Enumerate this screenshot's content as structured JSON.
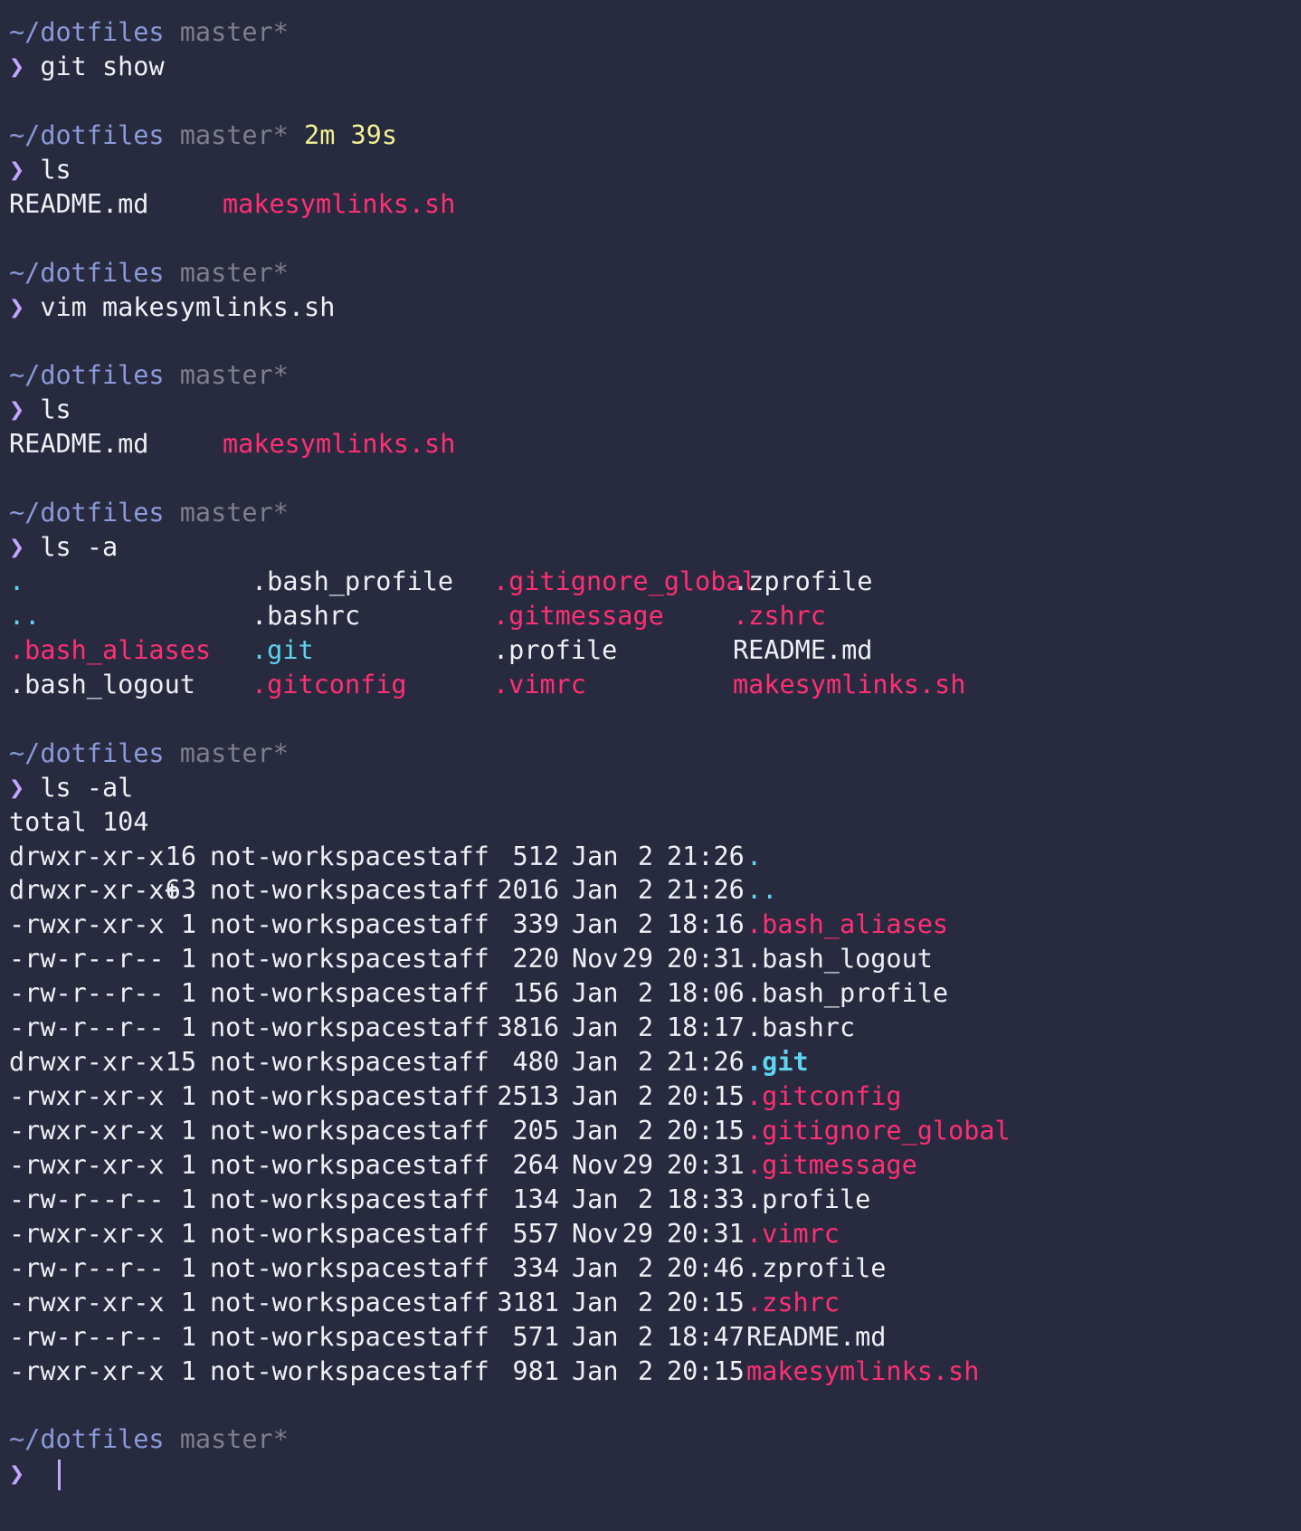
{
  "colors": {
    "background": "#282b3f",
    "path": "#8b9ad8",
    "branch": "#7d7f8e",
    "duration": "#f3f194",
    "prompt_symbol": "#c3a6ff",
    "default_text": "#eef0f5",
    "executable": "#ff2f73",
    "directory": "#5ed4ef"
  },
  "prompt_symbol": "❯",
  "blocks": [
    {
      "path": "~/dotfiles",
      "branch": "master*",
      "duration": "",
      "command": "git show",
      "output": []
    },
    {
      "path": "~/dotfiles",
      "branch": "master*",
      "duration": "2m 39s",
      "command": "ls",
      "output": [
        [
          {
            "text": "README.md",
            "kind": "file"
          },
          {
            "text": "makesymlinks.sh",
            "kind": "exec"
          }
        ]
      ]
    },
    {
      "path": "~/dotfiles",
      "branch": "master*",
      "duration": "",
      "command": "vim makesymlinks.sh",
      "output": []
    },
    {
      "path": "~/dotfiles",
      "branch": "master*",
      "duration": "",
      "command": "ls",
      "output": [
        [
          {
            "text": "README.md",
            "kind": "file"
          },
          {
            "text": "makesymlinks.sh",
            "kind": "exec"
          }
        ]
      ]
    },
    {
      "path": "~/dotfiles",
      "branch": "master*",
      "duration": "",
      "command": "ls -a",
      "output": [
        [
          {
            "text": ".",
            "kind": "dir"
          },
          {
            "text": ".bash_profile",
            "kind": "file"
          },
          {
            "text": ".gitignore_global",
            "kind": "exec"
          },
          {
            "text": ".zprofile",
            "kind": "file"
          }
        ],
        [
          {
            "text": "..",
            "kind": "dir"
          },
          {
            "text": ".bashrc",
            "kind": "file"
          },
          {
            "text": ".gitmessage",
            "kind": "exec"
          },
          {
            "text": ".zshrc",
            "kind": "exec"
          }
        ],
        [
          {
            "text": ".bash_aliases",
            "kind": "exec"
          },
          {
            "text": ".git",
            "kind": "dir"
          },
          {
            "text": ".profile",
            "kind": "file"
          },
          {
            "text": "README.md",
            "kind": "file"
          }
        ],
        [
          {
            "text": ".bash_logout",
            "kind": "file"
          },
          {
            "text": ".gitconfig",
            "kind": "exec"
          },
          {
            "text": ".vimrc",
            "kind": "exec"
          },
          {
            "text": "makesymlinks.sh",
            "kind": "exec"
          }
        ]
      ]
    },
    {
      "path": "~/dotfiles",
      "branch": "master*",
      "duration": "",
      "command": "ls -al",
      "total": "total 104",
      "long_listing": [
        {
          "perms": "drwxr-xr-x ",
          "links": "16",
          "owner": "not-workspace",
          "group": "staff",
          "size": "512",
          "month": "Jan",
          "day": "2",
          "time": "21:26",
          "name": ".",
          "kind": "dir"
        },
        {
          "perms": "drwxr-xr-x+",
          "links": "63",
          "owner": "not-workspace",
          "group": "staff",
          "size": "2016",
          "month": "Jan",
          "day": "2",
          "time": "21:26",
          "name": "..",
          "kind": "dir"
        },
        {
          "perms": "-rwxr-xr-x ",
          "links": "1",
          "owner": "not-workspace",
          "group": "staff",
          "size": "339",
          "month": "Jan",
          "day": "2",
          "time": "18:16",
          "name": ".bash_aliases",
          "kind": "exec"
        },
        {
          "perms": "-rw-r--r-- ",
          "links": "1",
          "owner": "not-workspace",
          "group": "staff",
          "size": "220",
          "month": "Nov",
          "day": "29",
          "time": "20:31",
          "name": ".bash_logout",
          "kind": "file"
        },
        {
          "perms": "-rw-r--r-- ",
          "links": "1",
          "owner": "not-workspace",
          "group": "staff",
          "size": "156",
          "month": "Jan",
          "day": "2",
          "time": "18:06",
          "name": ".bash_profile",
          "kind": "file"
        },
        {
          "perms": "-rw-r--r-- ",
          "links": "1",
          "owner": "not-workspace",
          "group": "staff",
          "size": "3816",
          "month": "Jan",
          "day": "2",
          "time": "18:17",
          "name": ".bashrc",
          "kind": "file"
        },
        {
          "perms": "drwxr-xr-x ",
          "links": "15",
          "owner": "not-workspace",
          "group": "staff",
          "size": "480",
          "month": "Jan",
          "day": "2",
          "time": "21:26",
          "name": ".git",
          "kind": "dir"
        },
        {
          "perms": "-rwxr-xr-x ",
          "links": "1",
          "owner": "not-workspace",
          "group": "staff",
          "size": "2513",
          "month": "Jan",
          "day": "2",
          "time": "20:15",
          "name": ".gitconfig",
          "kind": "exec"
        },
        {
          "perms": "-rwxr-xr-x ",
          "links": "1",
          "owner": "not-workspace",
          "group": "staff",
          "size": "205",
          "month": "Jan",
          "day": "2",
          "time": "20:15",
          "name": ".gitignore_global",
          "kind": "exec"
        },
        {
          "perms": "-rwxr-xr-x ",
          "links": "1",
          "owner": "not-workspace",
          "group": "staff",
          "size": "264",
          "month": "Nov",
          "day": "29",
          "time": "20:31",
          "name": ".gitmessage",
          "kind": "exec"
        },
        {
          "perms": "-rw-r--r-- ",
          "links": "1",
          "owner": "not-workspace",
          "group": "staff",
          "size": "134",
          "month": "Jan",
          "day": "2",
          "time": "18:33",
          "name": ".profile",
          "kind": "file"
        },
        {
          "perms": "-rwxr-xr-x ",
          "links": "1",
          "owner": "not-workspace",
          "group": "staff",
          "size": "557",
          "month": "Nov",
          "day": "29",
          "time": "20:31",
          "name": ".vimrc",
          "kind": "exec"
        },
        {
          "perms": "-rw-r--r-- ",
          "links": "1",
          "owner": "not-workspace",
          "group": "staff",
          "size": "334",
          "month": "Jan",
          "day": "2",
          "time": "20:46",
          "name": ".zprofile",
          "kind": "file"
        },
        {
          "perms": "-rwxr-xr-x ",
          "links": "1",
          "owner": "not-workspace",
          "group": "staff",
          "size": "3181",
          "month": "Jan",
          "day": "2",
          "time": "20:15",
          "name": ".zshrc",
          "kind": "exec"
        },
        {
          "perms": "-rw-r--r-- ",
          "links": "1",
          "owner": "not-workspace",
          "group": "staff",
          "size": "571",
          "month": "Jan",
          "day": "2",
          "time": "18:47",
          "name": "README.md",
          "kind": "file"
        },
        {
          "perms": "-rwxr-xr-x ",
          "links": "1",
          "owner": "not-workspace",
          "group": "staff",
          "size": "981",
          "month": "Jan",
          "day": "2",
          "time": "20:15",
          "name": "makesymlinks.sh",
          "kind": "exec"
        }
      ]
    },
    {
      "path": "~/dotfiles",
      "branch": "master*",
      "duration": "",
      "command": "",
      "output": []
    }
  ]
}
